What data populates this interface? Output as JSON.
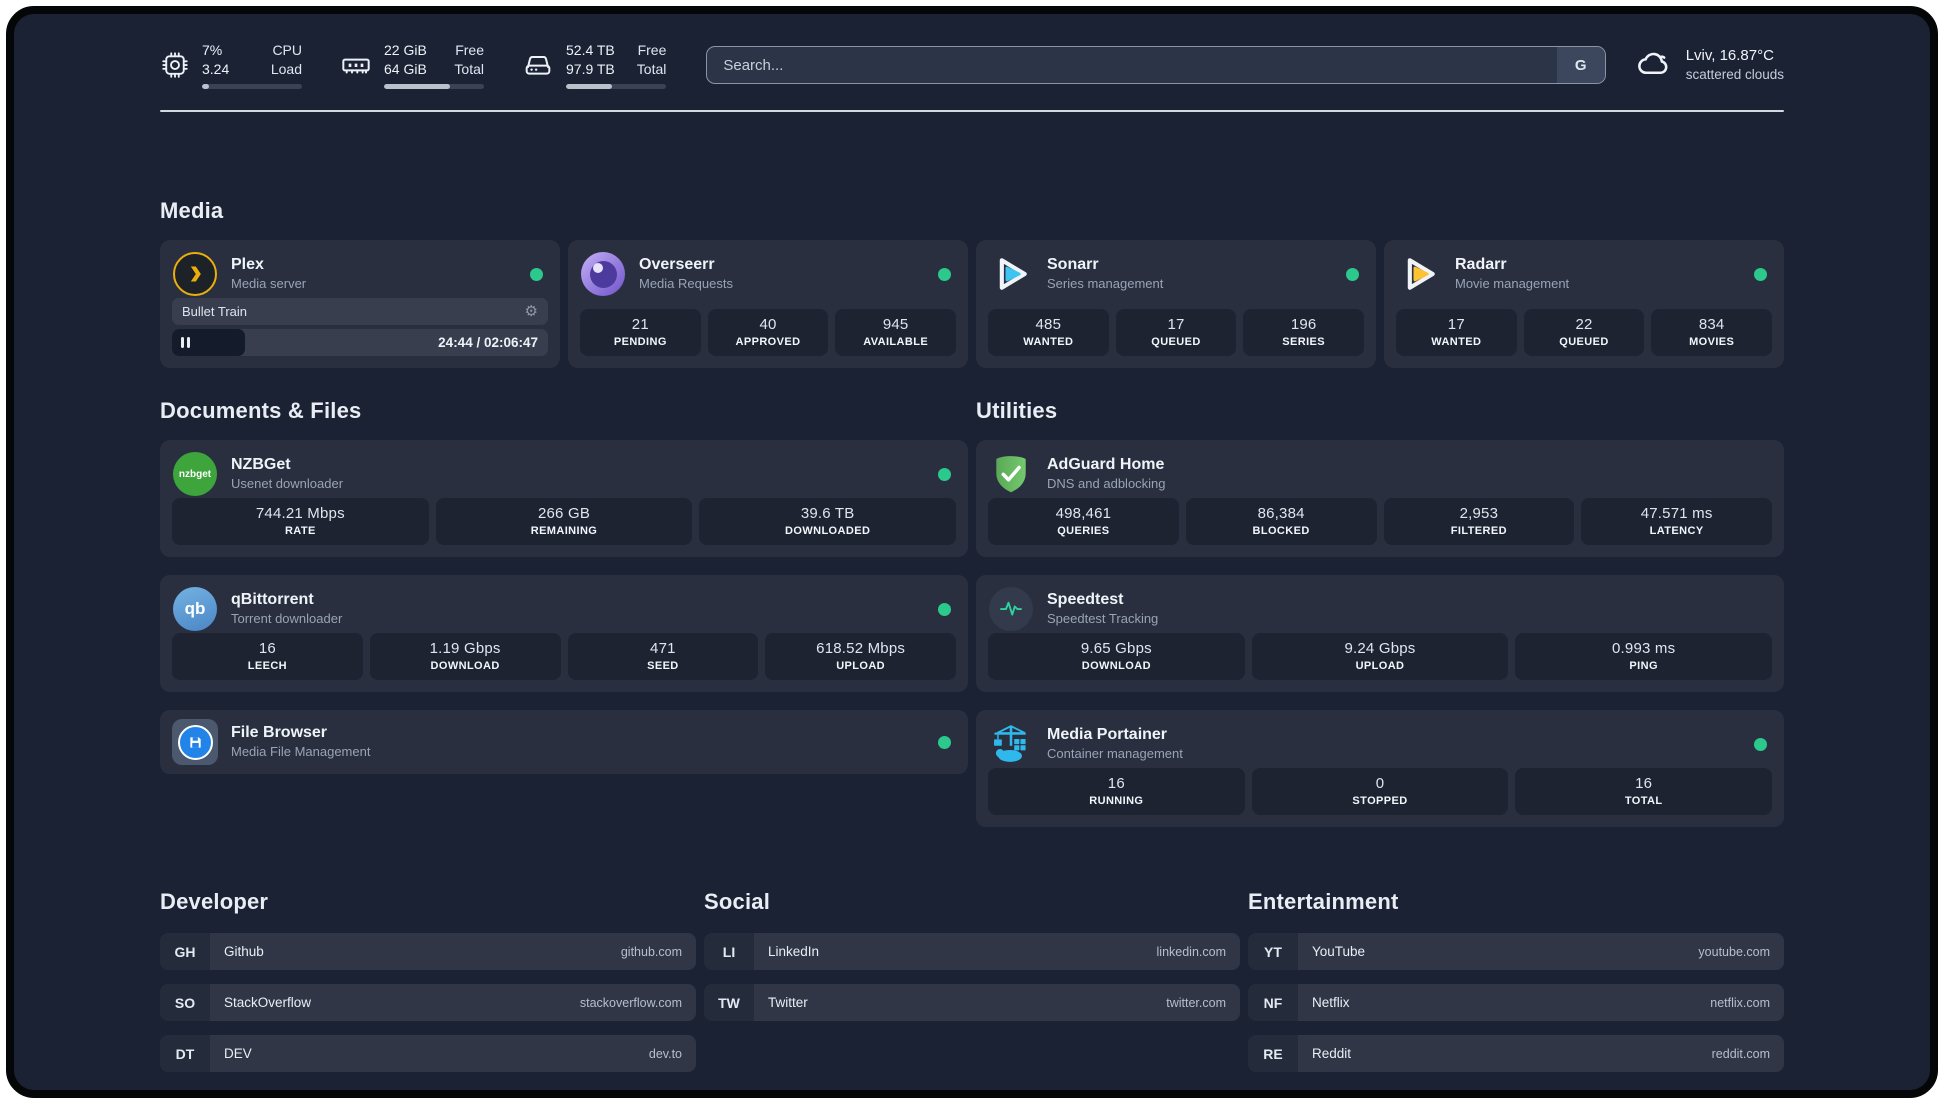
{
  "colors": {
    "page_bg": "#1b2233",
    "status_online": "#2bc98c",
    "plex_amber": "#ebaf0d",
    "sonarr_cyan": "#3cc5f1",
    "radarr_yellow": "#ffc230",
    "nzbget_green": "#3da53c",
    "qbittorrent_blue": "#5c9fd8",
    "filebrowser_blue": "#2284e8",
    "adguard_green": "#67b560",
    "speedtest_green": "#2dd4a0",
    "portainer_blue": "#2fb8ec",
    "overseerr_purple": "#7c5cdb"
  },
  "icons": {
    "settings_gear": "⚙",
    "nzbget_label": "nzbget",
    "qbittorrent_label": "qb"
  },
  "topbar": {
    "stats": [
      {
        "icon": "cpu-icon",
        "values": [
          "7%",
          "3.24"
        ],
        "labels": [
          "CPU",
          "Load"
        ],
        "progress": 7
      },
      {
        "icon": "memory-icon",
        "values": [
          "22 GiB",
          "64 GiB"
        ],
        "labels": [
          "Free",
          "Total"
        ],
        "progress": 66
      },
      {
        "icon": "disk-icon",
        "values": [
          "52.4 TB",
          "97.9 TB"
        ],
        "labels": [
          "Free",
          "Total"
        ],
        "progress": 46
      }
    ],
    "search": {
      "placeholder": "Search...",
      "provider_button": "G"
    },
    "weather": {
      "location": "Lviv, 16.87°C",
      "condition": "scattered clouds"
    }
  },
  "media": {
    "title": "Media",
    "plex": {
      "name": "Plex",
      "subtitle": "Media server",
      "online": true,
      "player": {
        "title": "Bullet Train",
        "time": "24:44 / 02:06:47",
        "progress_pct": 19.5,
        "state": "paused"
      }
    },
    "overseerr": {
      "name": "Overseerr",
      "subtitle": "Media Requests",
      "online": true,
      "stats": [
        {
          "value": "21",
          "label": "PENDING"
        },
        {
          "value": "40",
          "label": "APPROVED"
        },
        {
          "value": "945",
          "label": "AVAILABLE"
        }
      ]
    },
    "sonarr": {
      "name": "Sonarr",
      "subtitle": "Series management",
      "online": true,
      "stats": [
        {
          "value": "485",
          "label": "WANTED"
        },
        {
          "value": "17",
          "label": "QUEUED"
        },
        {
          "value": "196",
          "label": "SERIES"
        }
      ]
    },
    "radarr": {
      "name": "Radarr",
      "subtitle": "Movie management",
      "online": true,
      "stats": [
        {
          "value": "17",
          "label": "WANTED"
        },
        {
          "value": "22",
          "label": "QUEUED"
        },
        {
          "value": "834",
          "label": "MOVIES"
        }
      ]
    }
  },
  "documents": {
    "title": "Documents & Files",
    "nzbget": {
      "name": "NZBGet",
      "subtitle": "Usenet downloader",
      "online": true,
      "stats": [
        {
          "value": "744.21 Mbps",
          "label": "RATE"
        },
        {
          "value": "266 GB",
          "label": "REMAINING"
        },
        {
          "value": "39.6 TB",
          "label": "DOWNLOADED"
        }
      ]
    },
    "qbittorrent": {
      "name": "qBittorrent",
      "subtitle": "Torrent downloader",
      "online": true,
      "stats": [
        {
          "value": "16",
          "label": "LEECH"
        },
        {
          "value": "1.19 Gbps",
          "label": "DOWNLOAD"
        },
        {
          "value": "471",
          "label": "SEED"
        },
        {
          "value": "618.52 Mbps",
          "label": "UPLOAD"
        }
      ]
    },
    "filebrowser": {
      "name": "File Browser",
      "subtitle": "Media File Management",
      "online": true
    }
  },
  "utilities": {
    "title": "Utilities",
    "adguard": {
      "name": "AdGuard Home",
      "subtitle": "DNS and adblocking",
      "stats": [
        {
          "value": "498,461",
          "label": "QUERIES"
        },
        {
          "value": "86,384",
          "label": "BLOCKED"
        },
        {
          "value": "2,953",
          "label": "FILTERED"
        },
        {
          "value": "47.571 ms",
          "label": "LATENCY"
        }
      ]
    },
    "speedtest": {
      "name": "Speedtest",
      "subtitle": "Speedtest Tracking",
      "stats": [
        {
          "value": "9.65 Gbps",
          "label": "DOWNLOAD"
        },
        {
          "value": "9.24 Gbps",
          "label": "UPLOAD"
        },
        {
          "value": "0.993 ms",
          "label": "PING"
        }
      ]
    },
    "portainer": {
      "name": "Media Portainer",
      "subtitle": "Container management",
      "online": true,
      "stats": [
        {
          "value": "16",
          "label": "RUNNING"
        },
        {
          "value": "0",
          "label": "STOPPED"
        },
        {
          "value": "16",
          "label": "TOTAL"
        }
      ]
    }
  },
  "bookmarks": {
    "developer": {
      "title": "Developer",
      "items": [
        {
          "abbr": "GH",
          "name": "Github",
          "url": "github.com"
        },
        {
          "abbr": "SO",
          "name": "StackOverflow",
          "url": "stackoverflow.com"
        },
        {
          "abbr": "DT",
          "name": "DEV",
          "url": "dev.to"
        }
      ]
    },
    "social": {
      "title": "Social",
      "items": [
        {
          "abbr": "LI",
          "name": "LinkedIn",
          "url": "linkedin.com"
        },
        {
          "abbr": "TW",
          "name": "Twitter",
          "url": "twitter.com"
        }
      ]
    },
    "entertainment": {
      "title": "Entertainment",
      "items": [
        {
          "abbr": "YT",
          "name": "YouTube",
          "url": "youtube.com"
        },
        {
          "abbr": "NF",
          "name": "Netflix",
          "url": "netflix.com"
        },
        {
          "abbr": "RE",
          "name": "Reddit",
          "url": "reddit.com"
        }
      ]
    }
  }
}
